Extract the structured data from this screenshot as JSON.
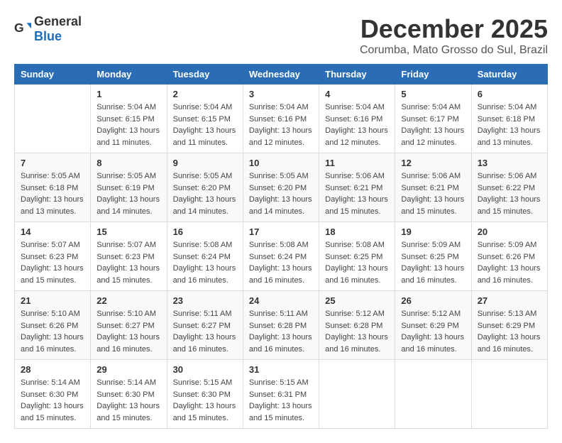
{
  "header": {
    "logo_general": "General",
    "logo_blue": "Blue",
    "title": "December 2025",
    "subtitle": "Corumba, Mato Grosso do Sul, Brazil"
  },
  "weekdays": [
    "Sunday",
    "Monday",
    "Tuesday",
    "Wednesday",
    "Thursday",
    "Friday",
    "Saturday"
  ],
  "weeks": [
    [
      {
        "day": "",
        "info": ""
      },
      {
        "day": "1",
        "info": "Sunrise: 5:04 AM\nSunset: 6:15 PM\nDaylight: 13 hours\nand 11 minutes."
      },
      {
        "day": "2",
        "info": "Sunrise: 5:04 AM\nSunset: 6:15 PM\nDaylight: 13 hours\nand 11 minutes."
      },
      {
        "day": "3",
        "info": "Sunrise: 5:04 AM\nSunset: 6:16 PM\nDaylight: 13 hours\nand 12 minutes."
      },
      {
        "day": "4",
        "info": "Sunrise: 5:04 AM\nSunset: 6:16 PM\nDaylight: 13 hours\nand 12 minutes."
      },
      {
        "day": "5",
        "info": "Sunrise: 5:04 AM\nSunset: 6:17 PM\nDaylight: 13 hours\nand 12 minutes."
      },
      {
        "day": "6",
        "info": "Sunrise: 5:04 AM\nSunset: 6:18 PM\nDaylight: 13 hours\nand 13 minutes."
      }
    ],
    [
      {
        "day": "7",
        "info": "Sunrise: 5:05 AM\nSunset: 6:18 PM\nDaylight: 13 hours\nand 13 minutes."
      },
      {
        "day": "8",
        "info": "Sunrise: 5:05 AM\nSunset: 6:19 PM\nDaylight: 13 hours\nand 14 minutes."
      },
      {
        "day": "9",
        "info": "Sunrise: 5:05 AM\nSunset: 6:20 PM\nDaylight: 13 hours\nand 14 minutes."
      },
      {
        "day": "10",
        "info": "Sunrise: 5:05 AM\nSunset: 6:20 PM\nDaylight: 13 hours\nand 14 minutes."
      },
      {
        "day": "11",
        "info": "Sunrise: 5:06 AM\nSunset: 6:21 PM\nDaylight: 13 hours\nand 15 minutes."
      },
      {
        "day": "12",
        "info": "Sunrise: 5:06 AM\nSunset: 6:21 PM\nDaylight: 13 hours\nand 15 minutes."
      },
      {
        "day": "13",
        "info": "Sunrise: 5:06 AM\nSunset: 6:22 PM\nDaylight: 13 hours\nand 15 minutes."
      }
    ],
    [
      {
        "day": "14",
        "info": "Sunrise: 5:07 AM\nSunset: 6:23 PM\nDaylight: 13 hours\nand 15 minutes."
      },
      {
        "day": "15",
        "info": "Sunrise: 5:07 AM\nSunset: 6:23 PM\nDaylight: 13 hours\nand 15 minutes."
      },
      {
        "day": "16",
        "info": "Sunrise: 5:08 AM\nSunset: 6:24 PM\nDaylight: 13 hours\nand 16 minutes."
      },
      {
        "day": "17",
        "info": "Sunrise: 5:08 AM\nSunset: 6:24 PM\nDaylight: 13 hours\nand 16 minutes."
      },
      {
        "day": "18",
        "info": "Sunrise: 5:08 AM\nSunset: 6:25 PM\nDaylight: 13 hours\nand 16 minutes."
      },
      {
        "day": "19",
        "info": "Sunrise: 5:09 AM\nSunset: 6:25 PM\nDaylight: 13 hours\nand 16 minutes."
      },
      {
        "day": "20",
        "info": "Sunrise: 5:09 AM\nSunset: 6:26 PM\nDaylight: 13 hours\nand 16 minutes."
      }
    ],
    [
      {
        "day": "21",
        "info": "Sunrise: 5:10 AM\nSunset: 6:26 PM\nDaylight: 13 hours\nand 16 minutes."
      },
      {
        "day": "22",
        "info": "Sunrise: 5:10 AM\nSunset: 6:27 PM\nDaylight: 13 hours\nand 16 minutes."
      },
      {
        "day": "23",
        "info": "Sunrise: 5:11 AM\nSunset: 6:27 PM\nDaylight: 13 hours\nand 16 minutes."
      },
      {
        "day": "24",
        "info": "Sunrise: 5:11 AM\nSunset: 6:28 PM\nDaylight: 13 hours\nand 16 minutes."
      },
      {
        "day": "25",
        "info": "Sunrise: 5:12 AM\nSunset: 6:28 PM\nDaylight: 13 hours\nand 16 minutes."
      },
      {
        "day": "26",
        "info": "Sunrise: 5:12 AM\nSunset: 6:29 PM\nDaylight: 13 hours\nand 16 minutes."
      },
      {
        "day": "27",
        "info": "Sunrise: 5:13 AM\nSunset: 6:29 PM\nDaylight: 13 hours\nand 16 minutes."
      }
    ],
    [
      {
        "day": "28",
        "info": "Sunrise: 5:14 AM\nSunset: 6:30 PM\nDaylight: 13 hours\nand 15 minutes."
      },
      {
        "day": "29",
        "info": "Sunrise: 5:14 AM\nSunset: 6:30 PM\nDaylight: 13 hours\nand 15 minutes."
      },
      {
        "day": "30",
        "info": "Sunrise: 5:15 AM\nSunset: 6:30 PM\nDaylight: 13 hours\nand 15 minutes."
      },
      {
        "day": "31",
        "info": "Sunrise: 5:15 AM\nSunset: 6:31 PM\nDaylight: 13 hours\nand 15 minutes."
      },
      {
        "day": "",
        "info": ""
      },
      {
        "day": "",
        "info": ""
      },
      {
        "day": "",
        "info": ""
      }
    ]
  ]
}
